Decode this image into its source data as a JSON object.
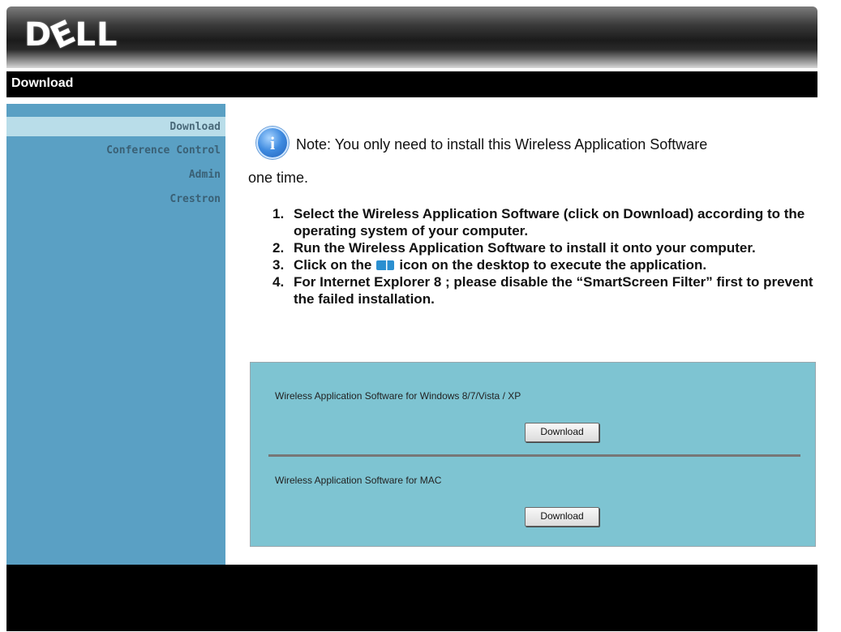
{
  "header": {
    "logo_text_left": "D",
    "logo_text_e": "E",
    "logo_text_right": "LL"
  },
  "titlebar": {
    "title": "Download"
  },
  "sidebar": {
    "items": [
      {
        "label": "Download",
        "active": true
      },
      {
        "label": "Conference Control",
        "active": false
      },
      {
        "label": "Admin",
        "active": false
      },
      {
        "label": "Crestron",
        "active": false
      }
    ]
  },
  "main": {
    "note_line1": "Note: You only need to install this Wireless Application Software",
    "note_line2": "one time.",
    "steps": [
      {
        "num": "1.",
        "text": "Select the Wireless Application Software (click on Download) according to the operating system of your computer."
      },
      {
        "num": "2.",
        "text": "Run the Wireless Application Software to install it onto your computer."
      },
      {
        "num": "3.",
        "text_before": "Click on the",
        "text_after": "icon on the desktop to execute the application."
      },
      {
        "num": "4.",
        "text": "For Internet Explorer 8 ; please disable the “SmartScreen Filter” first to prevent the failed installation."
      }
    ],
    "downloads": [
      {
        "label": "Wireless Application Software for Windows 8/7/Vista / XP",
        "button": "Download"
      },
      {
        "label": "Wireless Application Software for MAC",
        "button": "Download"
      }
    ]
  },
  "colors": {
    "sidebar": "#5aa0c4",
    "sidebar_active": "#b9dde9",
    "panel": "#7ec4d2",
    "bars": "#000000"
  },
  "icons": {
    "note": "info-icon",
    "desktop": "wireless-app-desktop-icon"
  }
}
